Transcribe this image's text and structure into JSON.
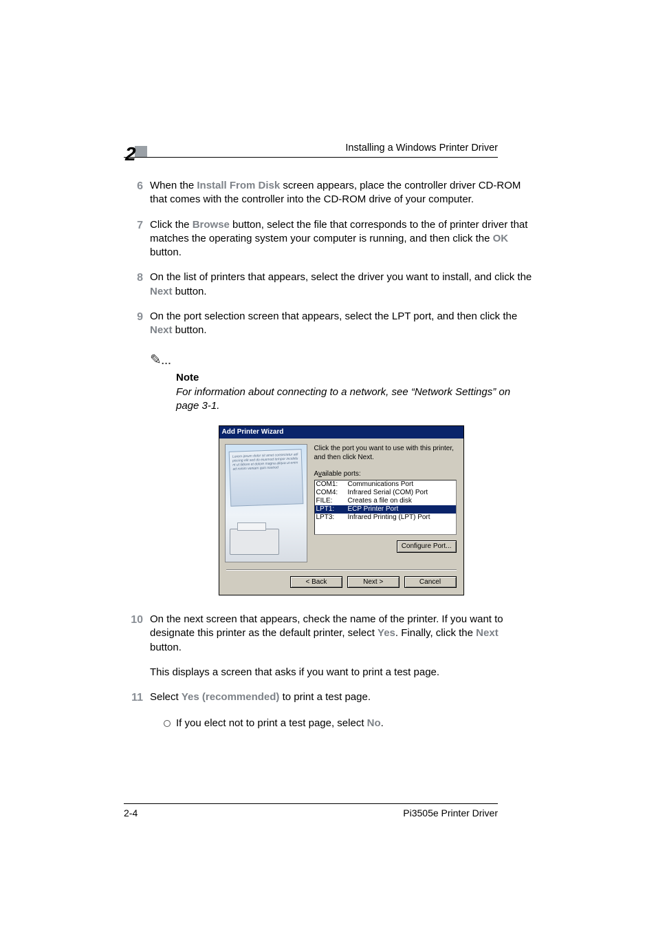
{
  "header": {
    "chapter_number": "2",
    "title": "Installing a Windows Printer Driver"
  },
  "steps": {
    "s6": {
      "num": "6",
      "pre": "When the ",
      "kw": "Install From Disk",
      "post": " screen appears, place the controller driver CD-ROM that comes with the controller into the CD-ROM drive of your computer."
    },
    "s7": {
      "num": "7",
      "pre": "Click the ",
      "kw1": "Browse",
      "mid": " button, select the file that corresponds to the of printer driver that matches the operating system your computer is running, and then click the ",
      "kw2": "OK",
      "post": " button."
    },
    "s8": {
      "num": "8",
      "pre": "On the list of printers that appears, select the driver you want to install, and click the ",
      "kw": "Next",
      "post": " button."
    },
    "s9": {
      "num": "9",
      "pre": "On the port selection screen that appears, select the LPT port, and then click the ",
      "kw": "Next",
      "post": " button."
    },
    "s10": {
      "num": "10",
      "pre": "On the next screen that appears, check the name of the printer. If you want to designate this printer as the default printer, select ",
      "kw1": "Yes",
      "mid": ". Finally, click the ",
      "kw2": "Next",
      "post": " button."
    },
    "s10b": "This displays a screen that asks if you want to print a test page.",
    "s11": {
      "num": "11",
      "pre": "Select ",
      "kw": "Yes (recommended)",
      "post": " to print a test page."
    },
    "s11sub": {
      "pre": "If you elect not to print a test page, select ",
      "kw": "No",
      "post": "."
    }
  },
  "note": {
    "label": "Note",
    "body": "For information about connecting to a network, see “Network Settings” on page 3-1."
  },
  "dialog": {
    "title": "Add Printer Wizard",
    "instruction": "Click the port you want to use with this printer, and then click Next.",
    "list_label_pre": "A",
    "list_label_ul": "v",
    "list_label_post": "ailable ports:",
    "rows": [
      {
        "c1": "COM1:",
        "c2": "Communications Port"
      },
      {
        "c1": "COM4:",
        "c2": "Infrared Serial (COM) Port"
      },
      {
        "c1": "FILE:",
        "c2": "Creates a file on disk"
      },
      {
        "c1": "LPT1:",
        "c2": "ECP Printer Port"
      },
      {
        "c1": "LPT3:",
        "c2": "Infrared Printing (LPT) Port"
      }
    ],
    "configure": "Configure Port...",
    "back": "< Back",
    "next": "Next >",
    "cancel": "Cancel"
  },
  "footer": {
    "page": "2-4",
    "product": "Pi3505e Printer Driver"
  }
}
